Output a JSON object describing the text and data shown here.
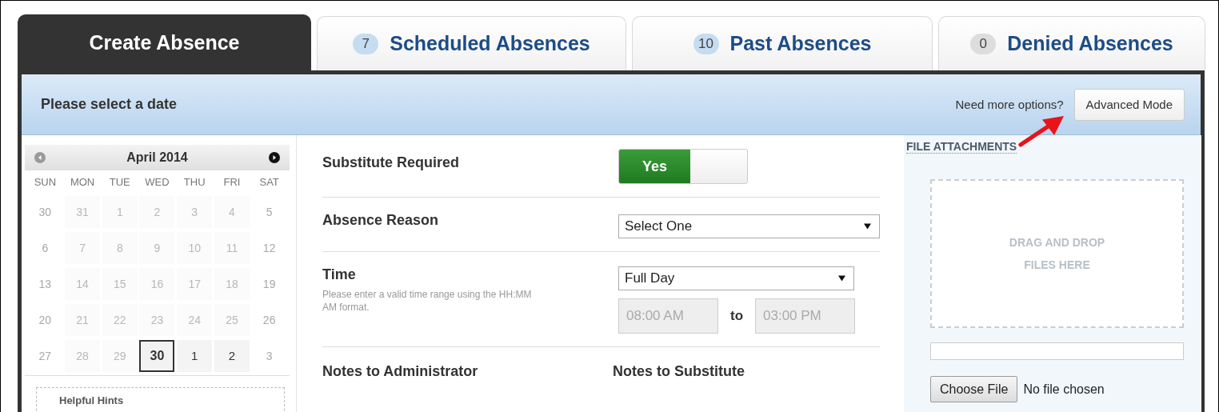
{
  "tabs": [
    {
      "label": "Create Absence",
      "selected": true
    },
    {
      "label": "Scheduled Absences",
      "count": "7",
      "color": "#c5dcf1",
      "selected": false
    },
    {
      "label": "Past Absences",
      "count": "10",
      "color": "#c5dcf1",
      "selected": false
    },
    {
      "label": "Denied Absences",
      "count": "0",
      "color": "#dddddd",
      "selected": false
    }
  ],
  "header": {
    "title": "Please select a date",
    "prompt": "Need more options?",
    "button": "Advanced Mode"
  },
  "calendar": {
    "month": "April 2014",
    "prev_disabled": true,
    "next_disabled": false,
    "weekdays": [
      "SUN",
      "MON",
      "TUE",
      "WED",
      "THU",
      "FRI",
      "SAT"
    ],
    "days": [
      {
        "label": "30",
        "disabled": true,
        "selected": false
      },
      {
        "label": "31",
        "disabled": true,
        "selected": false
      },
      {
        "label": "1",
        "disabled": true,
        "selected": false
      },
      {
        "label": "2",
        "disabled": true,
        "selected": false
      },
      {
        "label": "3",
        "disabled": true,
        "selected": false
      },
      {
        "label": "4",
        "disabled": true,
        "selected": false
      },
      {
        "label": "5",
        "disabled": true,
        "selected": false
      },
      {
        "label": "6",
        "disabled": true,
        "selected": false
      },
      {
        "label": "7",
        "disabled": true,
        "selected": false
      },
      {
        "label": "8",
        "disabled": true,
        "selected": false
      },
      {
        "label": "9",
        "disabled": true,
        "selected": false
      },
      {
        "label": "10",
        "disabled": true,
        "selected": false
      },
      {
        "label": "11",
        "disabled": true,
        "selected": false
      },
      {
        "label": "12",
        "disabled": true,
        "selected": false
      },
      {
        "label": "13",
        "disabled": true,
        "selected": false
      },
      {
        "label": "14",
        "disabled": true,
        "selected": false
      },
      {
        "label": "15",
        "disabled": true,
        "selected": false
      },
      {
        "label": "16",
        "disabled": true,
        "selected": false
      },
      {
        "label": "17",
        "disabled": true,
        "selected": false
      },
      {
        "label": "18",
        "disabled": true,
        "selected": false
      },
      {
        "label": "19",
        "disabled": true,
        "selected": false
      },
      {
        "label": "20",
        "disabled": true,
        "selected": false
      },
      {
        "label": "21",
        "disabled": true,
        "selected": false
      },
      {
        "label": "22",
        "disabled": true,
        "selected": false
      },
      {
        "label": "23",
        "disabled": true,
        "selected": false
      },
      {
        "label": "24",
        "disabled": true,
        "selected": false
      },
      {
        "label": "25",
        "disabled": true,
        "selected": false
      },
      {
        "label": "26",
        "disabled": true,
        "selected": false
      },
      {
        "label": "27",
        "disabled": true,
        "selected": false
      },
      {
        "label": "28",
        "disabled": true,
        "selected": false
      },
      {
        "label": "29",
        "disabled": true,
        "selected": false
      },
      {
        "label": "30",
        "disabled": false,
        "selected": true
      },
      {
        "label": "1",
        "disabled": false,
        "selected": false
      },
      {
        "label": "2",
        "disabled": false,
        "selected": false
      },
      {
        "label": "3",
        "disabled": true,
        "selected": false
      }
    ],
    "hints_title": "Helpful Hints"
  },
  "form": {
    "substitute": {
      "label": "Substitute Required",
      "toggle": "Yes",
      "on": true
    },
    "reason": {
      "label": "Absence Reason",
      "value": "Select One"
    },
    "time": {
      "label": "Time",
      "hint": "Please enter a valid time range using the HH:MM AM format.",
      "value": "Full Day",
      "start": "08:00 AM",
      "separator": "to",
      "end": "03:00 PM",
      "times_disabled": true
    },
    "notes_admin": "Notes to Administrator",
    "notes_sub": "Notes to Substitute"
  },
  "attachments": {
    "title": "FILE ATTACHMENTS",
    "drop_text": "DRAG AND DROP FILES HERE",
    "upload_progress": {
      "level": 0
    },
    "button": "Choose File",
    "file_status": "No file chosen"
  }
}
